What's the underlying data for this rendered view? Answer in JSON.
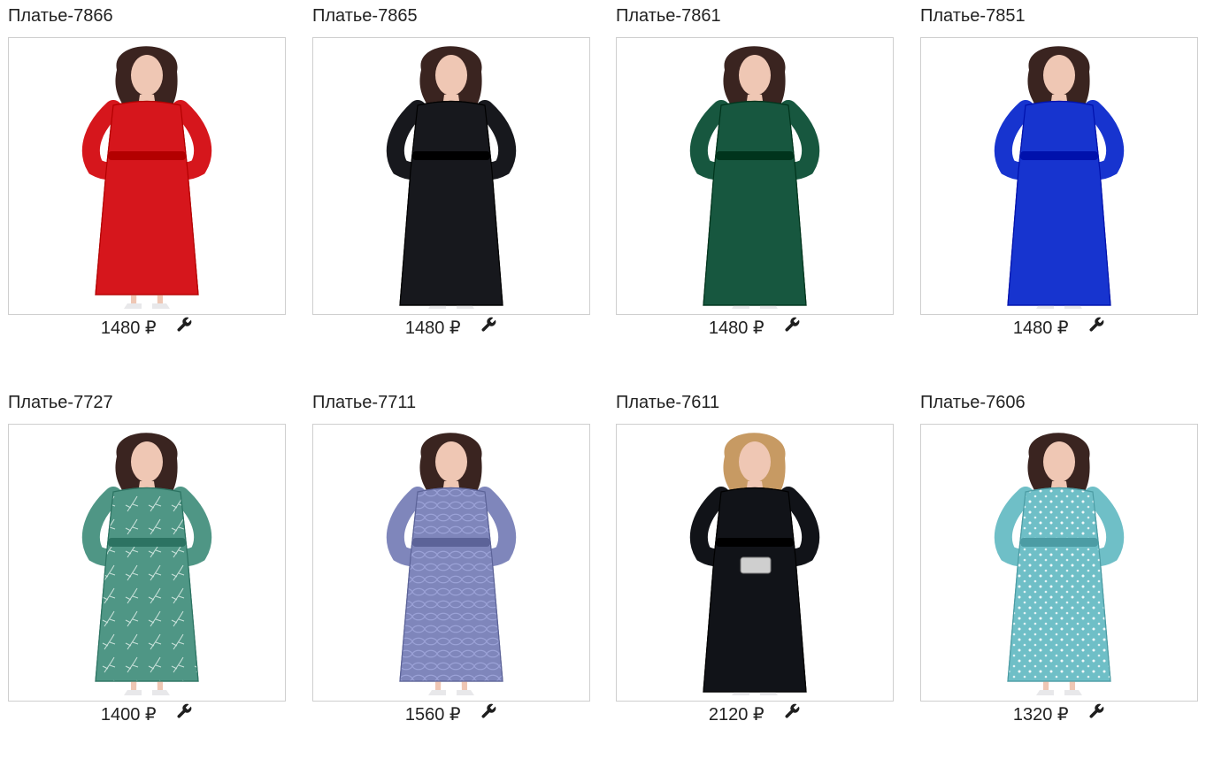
{
  "products": [
    {
      "title": "Платье-7866",
      "price": "1480 ₽",
      "dress_color": "#d6161c",
      "style": "midi",
      "hair_color": "#3b2420",
      "skin_color": "#efc7b4"
    },
    {
      "title": "Платье-7865",
      "price": "1480 ₽",
      "dress_color": "#17181d",
      "style": "maxi",
      "hair_color": "#3a2420",
      "skin_color": "#efc7b4"
    },
    {
      "title": "Платье-7861",
      "price": "1480 ₽",
      "dress_color": "#17573f",
      "style": "maxi",
      "hair_color": "#3a2420",
      "skin_color": "#efc7b4"
    },
    {
      "title": "Платье-7851",
      "price": "1480 ₽",
      "dress_color": "#1734cf",
      "style": "maxi",
      "hair_color": "#3a2420",
      "skin_color": "#efc7b4"
    },
    {
      "title": "Платье-7727",
      "price": "1400 ₽",
      "dress_color": "#4f9685",
      "style": "midi-print",
      "hair_color": "#3a2420",
      "skin_color": "#efc7b4"
    },
    {
      "title": "Платье-7711",
      "price": "1560 ₽",
      "dress_color": "#7f86bb",
      "style": "lace",
      "hair_color": "#3a2420",
      "skin_color": "#efc7b4"
    },
    {
      "title": "Платье-7611",
      "price": "2120 ₽",
      "dress_color": "#111318",
      "style": "maxi",
      "hair_color": "#c79a63",
      "skin_color": "#efc7b4"
    },
    {
      "title": "Платье-7606",
      "price": "1320 ₽",
      "dress_color": "#6fbfc7",
      "style": "polka",
      "hair_color": "#3a2420",
      "skin_color": "#efc7b4"
    }
  ],
  "icons": {
    "edit": "wrench-icon"
  }
}
